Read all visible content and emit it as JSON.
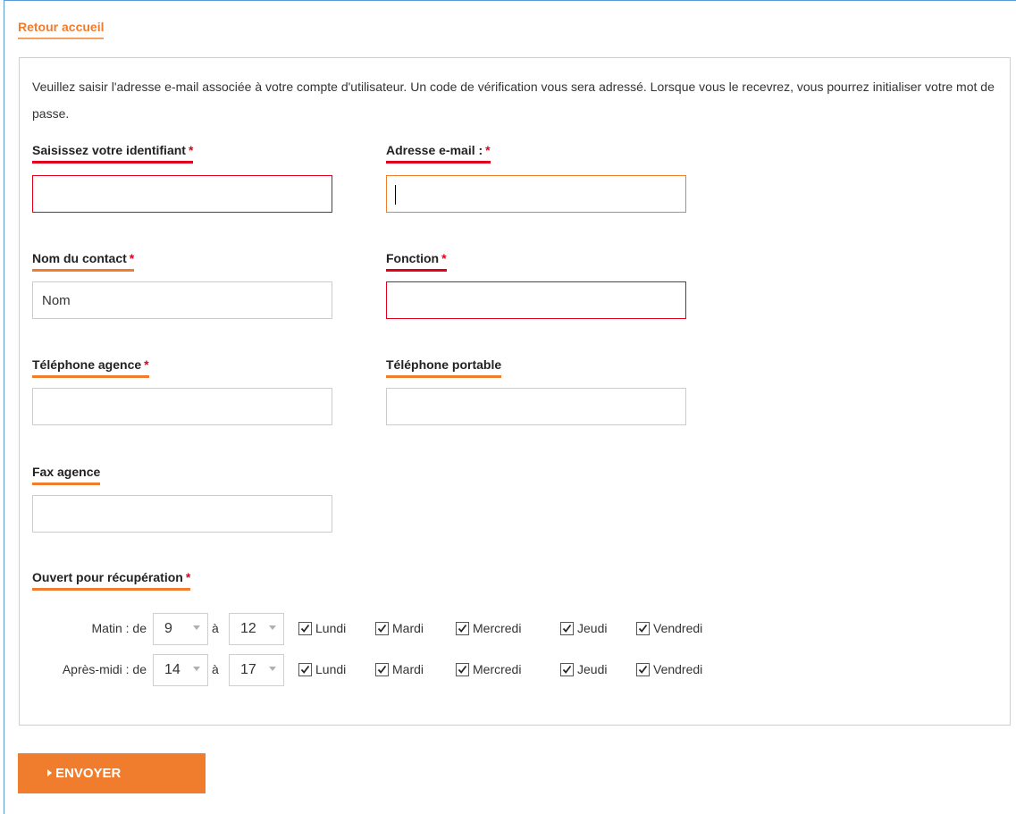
{
  "back_link": "Retour accueil",
  "intro": "Veuillez saisir l'adresse e-mail associée à votre compte d'utilisateur. Un code de vérification vous sera adressé. Lorsque vous le recevrez, vous pourrez initialiser votre mot de passe.",
  "required_marker": "*",
  "fields": {
    "identifiant": {
      "label": "Saisissez votre identifiant",
      "value": ""
    },
    "email": {
      "label": "Adresse e-mail :",
      "value": ""
    },
    "nom": {
      "label": "Nom du contact",
      "value": "Nom"
    },
    "fonction": {
      "label": "Fonction",
      "value": ""
    },
    "tel_agence": {
      "label": "Téléphone agence",
      "value": ""
    },
    "tel_portable": {
      "label": "Téléphone portable",
      "value": ""
    },
    "fax": {
      "label": "Fax agence",
      "value": ""
    }
  },
  "schedule": {
    "label": "Ouvert pour récupération",
    "to_word": "à",
    "rows": [
      {
        "label": "Matin : de",
        "from": "9",
        "to": "12"
      },
      {
        "label": "Après-midi : de",
        "from": "14",
        "to": "17"
      }
    ],
    "days": [
      "Lundi",
      "Mardi",
      "Mercredi",
      "Jeudi",
      "Vendredi"
    ],
    "checked": true
  },
  "submit": "ENVOYER",
  "colors": {
    "accent": "#f07d2e",
    "error": "#e0001b",
    "frame": "#5b9bd5"
  }
}
